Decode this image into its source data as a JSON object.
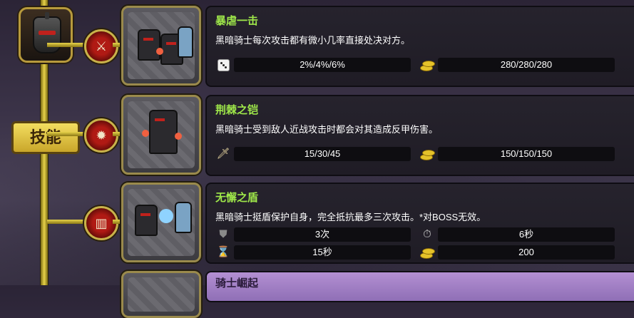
{
  "tab_label": "技能",
  "skills": [
    {
      "title": "暴虐一击",
      "description": "黑暗骑士每次攻击都有微小几率直接处决对方。",
      "stats": [
        {
          "icon": "dice-icon",
          "value": "2%/4%/6%"
        },
        {
          "icon": "gold-coins-icon",
          "value": "280/280/280"
        }
      ]
    },
    {
      "title": "荆棘之铠",
      "description": "黑暗骑士受到敌人近战攻击时都会对其造成反甲伤害。",
      "stats": [
        {
          "icon": "sword-icon",
          "value": "15/30/45"
        },
        {
          "icon": "gold-coins-icon",
          "value": "150/150/150"
        }
      ]
    },
    {
      "title": "无懈之盾",
      "description": "黑暗骑士挺盾保护自身，完全抵抗最多三次攻击。*对BOSS无效。",
      "stats": [
        {
          "icon": "shield-icon",
          "value": "3次"
        },
        {
          "icon": "stopwatch-icon",
          "value": "6秒"
        },
        {
          "icon": "hourglass-icon",
          "value": "15秒"
        },
        {
          "icon": "gold-coins-icon",
          "value": "200"
        }
      ]
    },
    {
      "title": "骑士崛起",
      "description": "",
      "stats": []
    }
  ]
}
